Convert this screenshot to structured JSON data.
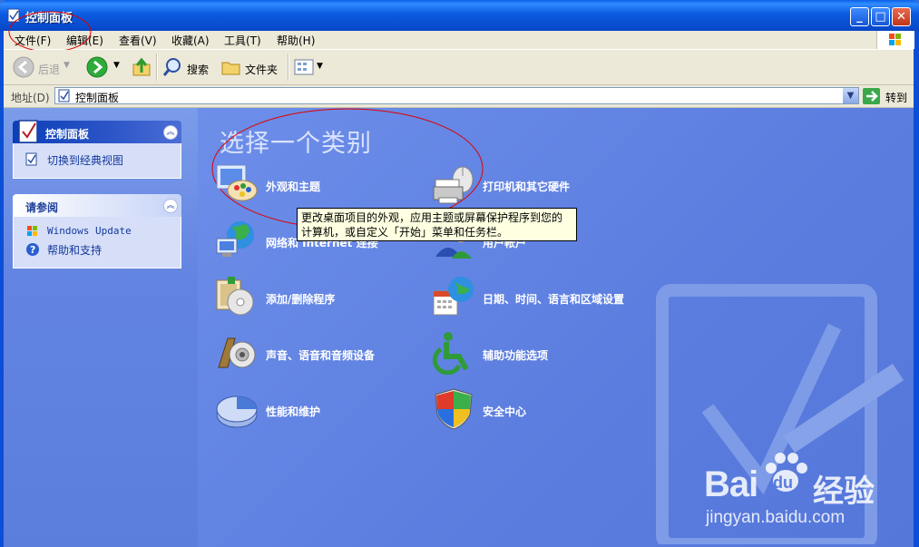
{
  "window": {
    "title": "控制面板"
  },
  "menu": [
    {
      "label": "文件(F)"
    },
    {
      "label": "编辑(E)"
    },
    {
      "label": "查看(V)"
    },
    {
      "label": "收藏(A)"
    },
    {
      "label": "工具(T)"
    },
    {
      "label": "帮助(H)"
    }
  ],
  "toolbar": {
    "back_label": "后退",
    "search_label": "搜索",
    "folders_label": "文件夹"
  },
  "address": {
    "label": "地址(D)",
    "value": "控制面板",
    "go_label": "转到"
  },
  "sidebar": {
    "control_panel": {
      "title": "控制面板",
      "switch_link": "切换到经典视图"
    },
    "see_also": {
      "title": "请参阅",
      "items": [
        "Windows Update",
        "帮助和支持"
      ]
    }
  },
  "main": {
    "heading": "选择一个类别",
    "categories": [
      {
        "label": "外观和主题",
        "icon": "appearance-icon"
      },
      {
        "label": "打印机和其它硬件",
        "icon": "printer-icon"
      },
      {
        "label": "网络和 Internet 连接",
        "icon": "network-icon"
      },
      {
        "label": "用户帐户",
        "icon": "users-icon"
      },
      {
        "label": "添加/删除程序",
        "icon": "programs-icon"
      },
      {
        "label": "日期、时间、语言和区域设置",
        "icon": "datetime-icon"
      },
      {
        "label": "声音、语音和音频设备",
        "icon": "sound-icon"
      },
      {
        "label": "辅助功能选项",
        "icon": "accessibility-icon"
      },
      {
        "label": "性能和维护",
        "icon": "performance-icon"
      },
      {
        "label": "安全中心",
        "icon": "security-icon"
      }
    ],
    "tooltip": "更改桌面项目的外观，应用主题或屏幕保护程序到您的计算机，或自定义「开始」菜单和任务栏。"
  },
  "watermark": {
    "brand_left": "Bai",
    "brand_right": "du",
    "brand_cn": "经验",
    "url": "jingyan.baidu.com"
  },
  "colors": {
    "titlebar": "#0b5ae0",
    "main_bg": "#5b7ddf",
    "sidebar_header": "#2d56c8"
  }
}
